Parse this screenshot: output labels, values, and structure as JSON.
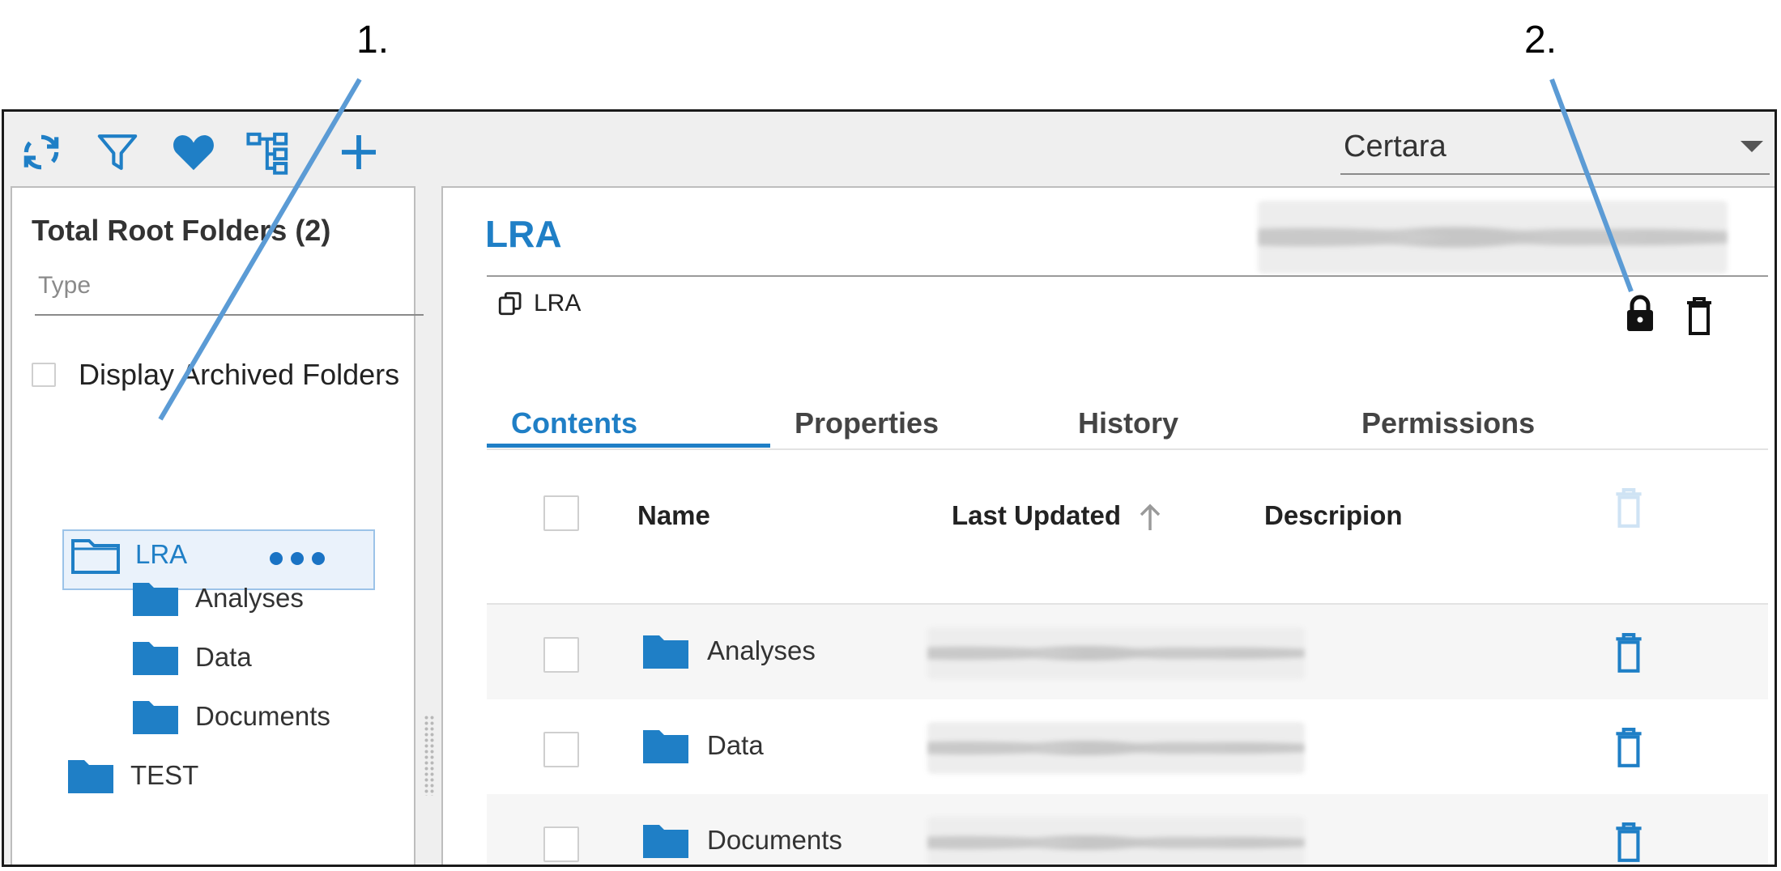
{
  "callouts": {
    "one": "1.",
    "two": "2."
  },
  "toolbar": {
    "icons": [
      "refresh-icon",
      "filter-icon",
      "favorite-heart-icon",
      "hierarchy-icon",
      "add-icon"
    ]
  },
  "account_select": {
    "value": "Certara"
  },
  "left_pane": {
    "title": "Total Root Folders (2)",
    "type_placeholder": "Type",
    "archived_label": "Display Archived Folders",
    "tree": {
      "lra": "LRA",
      "children": [
        "Analyses",
        "Data",
        "Documents"
      ],
      "test": "TEST"
    }
  },
  "right_pane": {
    "folder_title": "LRA",
    "path_label": "LRA",
    "tabs": [
      "Contents",
      "Properties",
      "History",
      "Permissions"
    ],
    "columns": {
      "name": "Name",
      "last_updated": "Last Updated",
      "description": "Descripion"
    },
    "rows": [
      {
        "name": "Analyses"
      },
      {
        "name": "Data"
      },
      {
        "name": "Documents"
      }
    ]
  },
  "colors": {
    "accent": "#1f7fc6",
    "callout_line": "#5b9bd5"
  }
}
